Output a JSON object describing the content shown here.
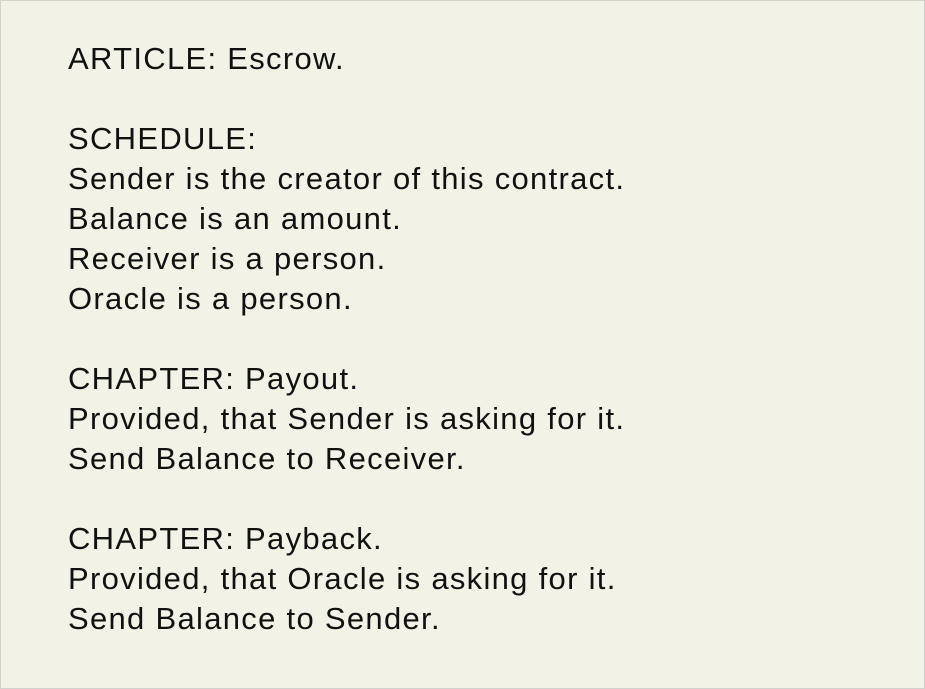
{
  "article": {
    "heading": "ARTICLE: Escrow."
  },
  "schedule": {
    "heading": "SCHEDULE:",
    "lines": [
      "Sender is the creator of this contract.",
      "Balance is an amount.",
      "Receiver is a person.",
      "Oracle is a person."
    ]
  },
  "chapters": [
    {
      "heading": "CHAPTER: Payout.",
      "lines": [
        "Provided, that Sender is asking for it.",
        "Send Balance to Receiver."
      ]
    },
    {
      "heading": "CHAPTER: Payback.",
      "lines": [
        "Provided, that Oracle is asking for it.",
        "Send Balance to Sender."
      ]
    }
  ]
}
